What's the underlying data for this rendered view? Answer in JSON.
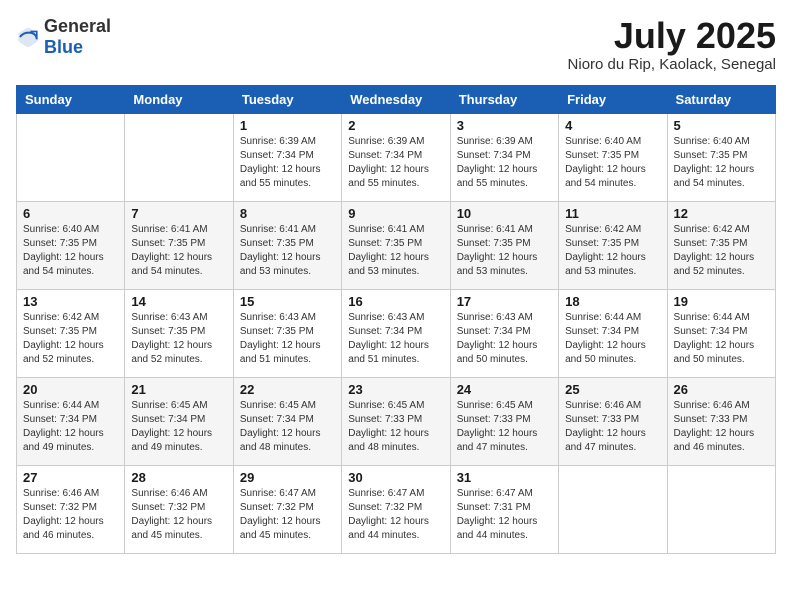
{
  "header": {
    "logo_general": "General",
    "logo_blue": "Blue",
    "month": "July 2025",
    "location": "Nioro du Rip, Kaolack, Senegal"
  },
  "days_of_week": [
    "Sunday",
    "Monday",
    "Tuesday",
    "Wednesday",
    "Thursday",
    "Friday",
    "Saturday"
  ],
  "weeks": [
    [
      {
        "day": "",
        "info": ""
      },
      {
        "day": "",
        "info": ""
      },
      {
        "day": "1",
        "sunrise": "Sunrise: 6:39 AM",
        "sunset": "Sunset: 7:34 PM",
        "daylight": "Daylight: 12 hours and 55 minutes."
      },
      {
        "day": "2",
        "sunrise": "Sunrise: 6:39 AM",
        "sunset": "Sunset: 7:34 PM",
        "daylight": "Daylight: 12 hours and 55 minutes."
      },
      {
        "day": "3",
        "sunrise": "Sunrise: 6:39 AM",
        "sunset": "Sunset: 7:34 PM",
        "daylight": "Daylight: 12 hours and 55 minutes."
      },
      {
        "day": "4",
        "sunrise": "Sunrise: 6:40 AM",
        "sunset": "Sunset: 7:35 PM",
        "daylight": "Daylight: 12 hours and 54 minutes."
      },
      {
        "day": "5",
        "sunrise": "Sunrise: 6:40 AM",
        "sunset": "Sunset: 7:35 PM",
        "daylight": "Daylight: 12 hours and 54 minutes."
      }
    ],
    [
      {
        "day": "6",
        "sunrise": "Sunrise: 6:40 AM",
        "sunset": "Sunset: 7:35 PM",
        "daylight": "Daylight: 12 hours and 54 minutes."
      },
      {
        "day": "7",
        "sunrise": "Sunrise: 6:41 AM",
        "sunset": "Sunset: 7:35 PM",
        "daylight": "Daylight: 12 hours and 54 minutes."
      },
      {
        "day": "8",
        "sunrise": "Sunrise: 6:41 AM",
        "sunset": "Sunset: 7:35 PM",
        "daylight": "Daylight: 12 hours and 53 minutes."
      },
      {
        "day": "9",
        "sunrise": "Sunrise: 6:41 AM",
        "sunset": "Sunset: 7:35 PM",
        "daylight": "Daylight: 12 hours and 53 minutes."
      },
      {
        "day": "10",
        "sunrise": "Sunrise: 6:41 AM",
        "sunset": "Sunset: 7:35 PM",
        "daylight": "Daylight: 12 hours and 53 minutes."
      },
      {
        "day": "11",
        "sunrise": "Sunrise: 6:42 AM",
        "sunset": "Sunset: 7:35 PM",
        "daylight": "Daylight: 12 hours and 53 minutes."
      },
      {
        "day": "12",
        "sunrise": "Sunrise: 6:42 AM",
        "sunset": "Sunset: 7:35 PM",
        "daylight": "Daylight: 12 hours and 52 minutes."
      }
    ],
    [
      {
        "day": "13",
        "sunrise": "Sunrise: 6:42 AM",
        "sunset": "Sunset: 7:35 PM",
        "daylight": "Daylight: 12 hours and 52 minutes."
      },
      {
        "day": "14",
        "sunrise": "Sunrise: 6:43 AM",
        "sunset": "Sunset: 7:35 PM",
        "daylight": "Daylight: 12 hours and 52 minutes."
      },
      {
        "day": "15",
        "sunrise": "Sunrise: 6:43 AM",
        "sunset": "Sunset: 7:35 PM",
        "daylight": "Daylight: 12 hours and 51 minutes."
      },
      {
        "day": "16",
        "sunrise": "Sunrise: 6:43 AM",
        "sunset": "Sunset: 7:34 PM",
        "daylight": "Daylight: 12 hours and 51 minutes."
      },
      {
        "day": "17",
        "sunrise": "Sunrise: 6:43 AM",
        "sunset": "Sunset: 7:34 PM",
        "daylight": "Daylight: 12 hours and 50 minutes."
      },
      {
        "day": "18",
        "sunrise": "Sunrise: 6:44 AM",
        "sunset": "Sunset: 7:34 PM",
        "daylight": "Daylight: 12 hours and 50 minutes."
      },
      {
        "day": "19",
        "sunrise": "Sunrise: 6:44 AM",
        "sunset": "Sunset: 7:34 PM",
        "daylight": "Daylight: 12 hours and 50 minutes."
      }
    ],
    [
      {
        "day": "20",
        "sunrise": "Sunrise: 6:44 AM",
        "sunset": "Sunset: 7:34 PM",
        "daylight": "Daylight: 12 hours and 49 minutes."
      },
      {
        "day": "21",
        "sunrise": "Sunrise: 6:45 AM",
        "sunset": "Sunset: 7:34 PM",
        "daylight": "Daylight: 12 hours and 49 minutes."
      },
      {
        "day": "22",
        "sunrise": "Sunrise: 6:45 AM",
        "sunset": "Sunset: 7:34 PM",
        "daylight": "Daylight: 12 hours and 48 minutes."
      },
      {
        "day": "23",
        "sunrise": "Sunrise: 6:45 AM",
        "sunset": "Sunset: 7:33 PM",
        "daylight": "Daylight: 12 hours and 48 minutes."
      },
      {
        "day": "24",
        "sunrise": "Sunrise: 6:45 AM",
        "sunset": "Sunset: 7:33 PM",
        "daylight": "Daylight: 12 hours and 47 minutes."
      },
      {
        "day": "25",
        "sunrise": "Sunrise: 6:46 AM",
        "sunset": "Sunset: 7:33 PM",
        "daylight": "Daylight: 12 hours and 47 minutes."
      },
      {
        "day": "26",
        "sunrise": "Sunrise: 6:46 AM",
        "sunset": "Sunset: 7:33 PM",
        "daylight": "Daylight: 12 hours and 46 minutes."
      }
    ],
    [
      {
        "day": "27",
        "sunrise": "Sunrise: 6:46 AM",
        "sunset": "Sunset: 7:32 PM",
        "daylight": "Daylight: 12 hours and 46 minutes."
      },
      {
        "day": "28",
        "sunrise": "Sunrise: 6:46 AM",
        "sunset": "Sunset: 7:32 PM",
        "daylight": "Daylight: 12 hours and 45 minutes."
      },
      {
        "day": "29",
        "sunrise": "Sunrise: 6:47 AM",
        "sunset": "Sunset: 7:32 PM",
        "daylight": "Daylight: 12 hours and 45 minutes."
      },
      {
        "day": "30",
        "sunrise": "Sunrise: 6:47 AM",
        "sunset": "Sunset: 7:32 PM",
        "daylight": "Daylight: 12 hours and 44 minutes."
      },
      {
        "day": "31",
        "sunrise": "Sunrise: 6:47 AM",
        "sunset": "Sunset: 7:31 PM",
        "daylight": "Daylight: 12 hours and 44 minutes."
      },
      {
        "day": "",
        "info": ""
      },
      {
        "day": "",
        "info": ""
      }
    ]
  ]
}
